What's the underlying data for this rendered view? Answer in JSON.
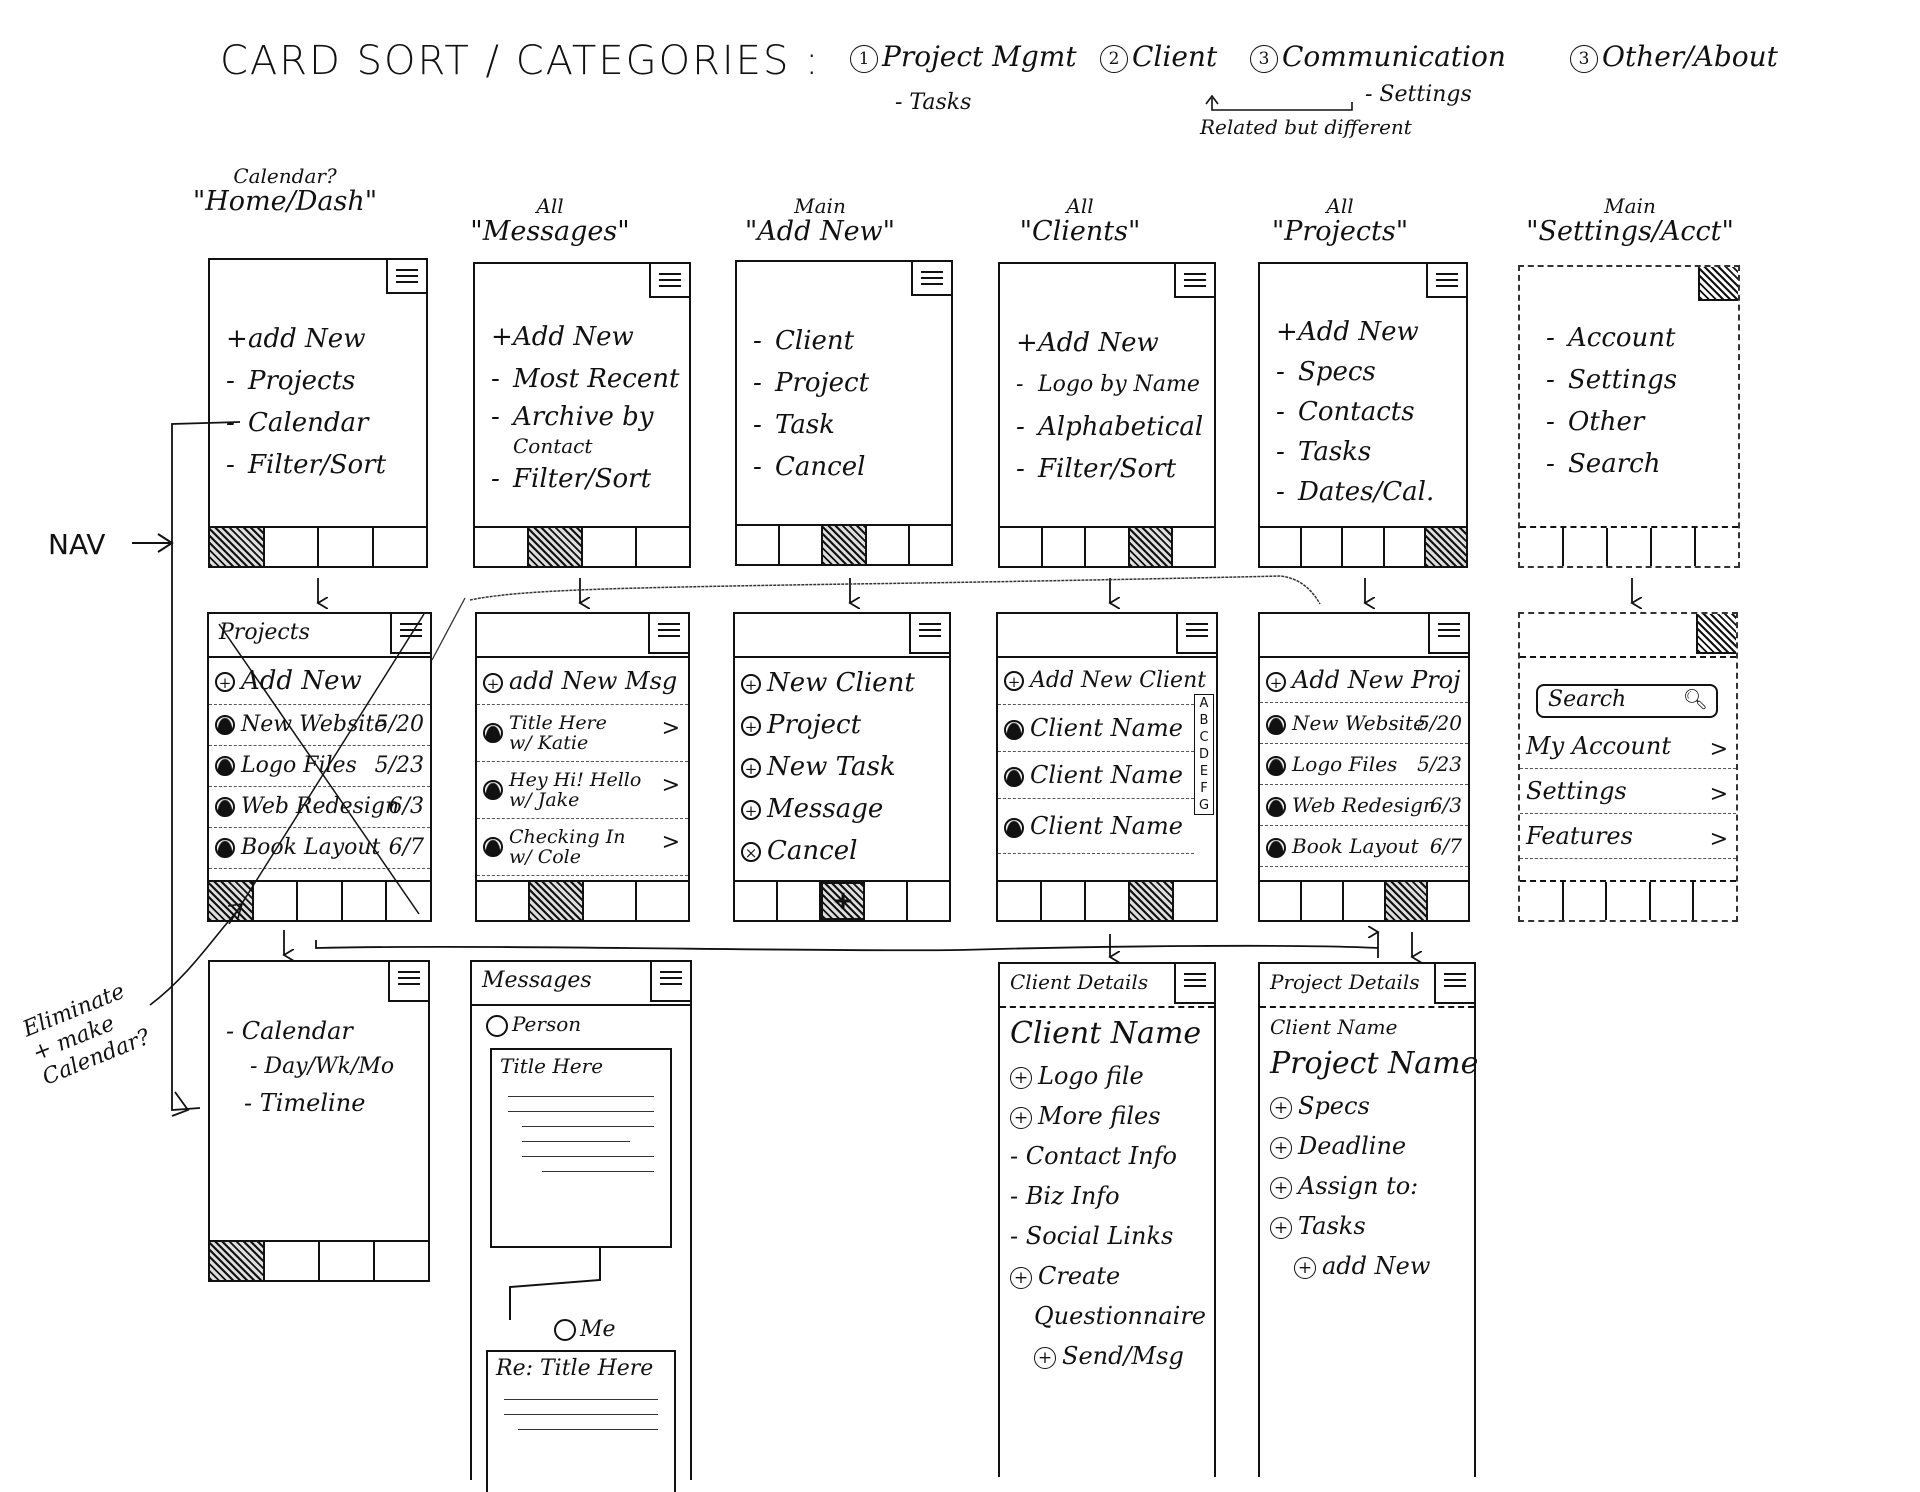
{
  "heading": {
    "title": "CARD SORT / CATEGORIES :",
    "categories": [
      {
        "number": "1",
        "label": "Project Mgmt",
        "sub": "- Tasks"
      },
      {
        "number": "2",
        "label": "Client"
      },
      {
        "number": "3",
        "label": "Communication",
        "sub": "- Settings"
      },
      {
        "number": "3",
        "label": "Other/About"
      }
    ],
    "relation_note": "Related but different"
  },
  "annotations": {
    "nav_label": "NAV",
    "eliminate_note_1": "Eliminate",
    "eliminate_note_2": "+ make",
    "eliminate_note_3": "Calendar?"
  },
  "screens_row1": [
    {
      "pre": "Calendar?",
      "title": "\"Home/Dash\"",
      "items": [
        {
          "bullet": "+",
          "label": "add New"
        },
        {
          "bullet": "-",
          "label": "Projects"
        },
        {
          "bullet": "-",
          "label": "Calendar"
        },
        {
          "bullet": "-",
          "label": "Filter/Sort"
        }
      ],
      "active_tab": 0
    },
    {
      "pre": "All",
      "title": "\"Messages\"",
      "items": [
        {
          "bullet": "+",
          "label": "Add New"
        },
        {
          "bullet": "-",
          "label": "Most Recent"
        },
        {
          "bullet": "-",
          "label": "Archive by"
        },
        {
          "bullet": "",
          "label": "Contact"
        },
        {
          "bullet": "-",
          "label": "Filter/Sort"
        }
      ],
      "active_tab": 1
    },
    {
      "pre": "Main",
      "title": "\"Add New\"",
      "items": [
        {
          "bullet": "-",
          "label": "Client"
        },
        {
          "bullet": "-",
          "label": "Project"
        },
        {
          "bullet": "-",
          "label": "Task"
        },
        {
          "bullet": "-",
          "label": "Cancel"
        }
      ],
      "active_tab": 2
    },
    {
      "pre": "All",
      "title": "\"Clients\"",
      "items": [
        {
          "bullet": "+",
          "label": "Add New"
        },
        {
          "bullet": "-",
          "label": "Logo by Name"
        },
        {
          "bullet": "-",
          "label": "Alphabetical"
        },
        {
          "bullet": "-",
          "label": "Filter/Sort"
        }
      ],
      "active_tab": 3
    },
    {
      "pre": "All",
      "title": "\"Projects\"",
      "items": [
        {
          "bullet": "+",
          "label": "Add New"
        },
        {
          "bullet": "-",
          "label": "Specs"
        },
        {
          "bullet": "-",
          "label": "Contacts"
        },
        {
          "bullet": "-",
          "label": "Tasks"
        },
        {
          "bullet": "-",
          "label": "Dates/Cal."
        }
      ],
      "active_tab": 4
    },
    {
      "pre": "Main",
      "title": "\"Settings/Acct\"",
      "items": [
        {
          "bullet": "-",
          "label": "Account"
        },
        {
          "bullet": "-",
          "label": "Settings"
        },
        {
          "bullet": "-",
          "label": "Other"
        },
        {
          "bullet": "-",
          "label": "Search"
        }
      ],
      "active_tab": -1
    }
  ],
  "screens_row2": {
    "projects": {
      "header": "Projects",
      "add": "Add New",
      "rows": [
        {
          "name": "New Website",
          "date": "5/20"
        },
        {
          "name": "Logo Files",
          "date": "5/23"
        },
        {
          "name": "Web Redesign",
          "date": "6/3"
        },
        {
          "name": "Book Layout",
          "date": "6/7"
        }
      ]
    },
    "messages": {
      "add": "add New Msg",
      "rows": [
        {
          "line1": "Title Here",
          "line2": "w/ Katie"
        },
        {
          "line1": "Hey Hi! Hello",
          "line2": "w/ Jake"
        },
        {
          "line1": "Checking In",
          "line2": "w/ Cole"
        }
      ],
      "chevron": ">"
    },
    "add_new": {
      "rows": [
        {
          "icon": "+",
          "label": "New Client"
        },
        {
          "icon": "+",
          "label": "Project"
        },
        {
          "icon": "+",
          "label": "New Task"
        },
        {
          "icon": "+",
          "label": "Message"
        },
        {
          "icon": "×",
          "label": "Cancel"
        }
      ],
      "fab": "+"
    },
    "clients": {
      "add": "Add New Client",
      "rows": [
        "Client Name",
        "Client Name",
        "Client Name"
      ],
      "alpha_index": [
        "A",
        "B",
        "C",
        "D",
        "E",
        "F",
        "G"
      ]
    },
    "projects_all": {
      "add": "Add New Proj",
      "rows": [
        {
          "name": "New Website",
          "date": "5/20"
        },
        {
          "name": "Logo Files",
          "date": "5/23"
        },
        {
          "name": "Web Redesign",
          "date": "6/3"
        },
        {
          "name": "Book Layout",
          "date": "6/7"
        }
      ]
    },
    "settings": {
      "search_placeholder": "Search",
      "rows": [
        "My Account",
        "Settings",
        "Features"
      ],
      "chevron": ">"
    }
  },
  "screens_row3": {
    "calendar": {
      "items": [
        {
          "label": "- Calendar"
        },
        {
          "label": "- Day/Wk/Mo",
          "indent": true
        },
        {
          "label": "- Timeline"
        }
      ]
    },
    "message_thread": {
      "header": "Messages",
      "person": "Person",
      "card_title": "Title Here",
      "me": "Me",
      "reply_title": "Re: Title Here"
    },
    "client_details": {
      "header": "Client Details",
      "items": [
        {
          "icon": "",
          "label": "Client Name",
          "big": true
        },
        {
          "icon": "+",
          "label": "Logo file"
        },
        {
          "icon": "+",
          "label": "More files"
        },
        {
          "icon": "-",
          "label": "Contact Info"
        },
        {
          "icon": "-",
          "label": "Biz Info"
        },
        {
          "icon": "-",
          "label": "Social Links"
        },
        {
          "icon": "+",
          "label": "Create"
        },
        {
          "icon": "",
          "label": "Questionnaire",
          "indent": true
        },
        {
          "icon": "+",
          "label": "Send/Msg",
          "indent": true
        }
      ]
    },
    "project_details": {
      "header": "Project Details",
      "client_name": "Client Name",
      "project_name": "Project Name",
      "items": [
        {
          "icon": "+",
          "label": "Specs"
        },
        {
          "icon": "+",
          "label": "Deadline"
        },
        {
          "icon": "+",
          "label": "Assign to:"
        },
        {
          "icon": "+",
          "label": "Tasks"
        },
        {
          "icon": "+",
          "label": "add New",
          "indent": true
        }
      ]
    }
  }
}
